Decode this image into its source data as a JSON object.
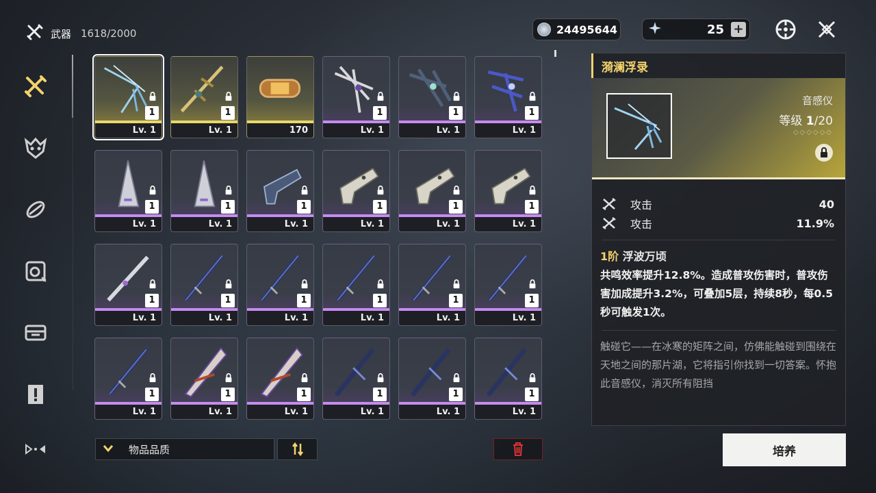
{
  "header": {
    "title": "武器",
    "count": "1618/2000"
  },
  "currency": {
    "amount": "24495644",
    "icon": "coin-icon"
  },
  "stamina": {
    "amount": "25",
    "plus": "+"
  },
  "top_icons": [
    "compass-icon",
    "close-icon"
  ],
  "left_nav": [
    "weapon-icon",
    "echo-icon",
    "upgrade-material-icon",
    "synthesis-icon",
    "resource-icon",
    "quest-item-icon",
    "misc-icon"
  ],
  "items": [
    {
      "label": "Lv. 1",
      "qty": "1",
      "rarity": "gold",
      "locked": true,
      "selected": true,
      "kind": "rectifier"
    },
    {
      "label": "Lv. 1",
      "qty": "1",
      "rarity": "gold",
      "locked": true,
      "kind": "sword-gold"
    },
    {
      "label": "170",
      "qty": "",
      "rarity": "gold",
      "locked": false,
      "kind": "capsule"
    },
    {
      "label": "Lv. 1",
      "qty": "1",
      "rarity": "purple",
      "locked": true,
      "kind": "rectifier-silver"
    },
    {
      "label": "Lv. 1",
      "qty": "1",
      "rarity": "purple",
      "locked": true,
      "kind": "rectifier-dark"
    },
    {
      "label": "Lv. 1",
      "qty": "1",
      "rarity": "purple",
      "locked": true,
      "kind": "rectifier-blue"
    },
    {
      "label": "Lv. 1",
      "qty": "1",
      "rarity": "purple",
      "locked": true,
      "kind": "gauntlet"
    },
    {
      "label": "Lv. 1",
      "qty": "1",
      "rarity": "purple",
      "locked": true,
      "kind": "gauntlet"
    },
    {
      "label": "Lv. 1",
      "qty": "1",
      "rarity": "purple",
      "locked": true,
      "kind": "pistol"
    },
    {
      "label": "Lv. 1",
      "qty": "1",
      "rarity": "purple",
      "locked": true,
      "kind": "pistol-white"
    },
    {
      "label": "Lv. 1",
      "qty": "1",
      "rarity": "purple",
      "locked": true,
      "kind": "pistol-white"
    },
    {
      "label": "Lv. 1",
      "qty": "1",
      "rarity": "purple",
      "locked": true,
      "kind": "pistol-white"
    },
    {
      "label": "Lv. 1",
      "qty": "1",
      "rarity": "purple",
      "locked": true,
      "kind": "sword"
    },
    {
      "label": "Lv. 1",
      "qty": "1",
      "rarity": "purple",
      "locked": true,
      "kind": "blade"
    },
    {
      "label": "Lv. 1",
      "qty": "1",
      "rarity": "purple",
      "locked": true,
      "kind": "blade"
    },
    {
      "label": "Lv. 1",
      "qty": "1",
      "rarity": "purple",
      "locked": true,
      "kind": "blade"
    },
    {
      "label": "Lv. 1",
      "qty": "1",
      "rarity": "purple",
      "locked": true,
      "kind": "blade"
    },
    {
      "label": "Lv. 1",
      "qty": "1",
      "rarity": "purple",
      "locked": true,
      "kind": "blade"
    },
    {
      "label": "Lv. 1",
      "qty": "1",
      "rarity": "purple",
      "locked": true,
      "kind": "blade"
    },
    {
      "label": "Lv. 1",
      "qty": "1",
      "rarity": "purple",
      "locked": true,
      "kind": "broadblade"
    },
    {
      "label": "Lv. 1",
      "qty": "1",
      "rarity": "purple",
      "locked": true,
      "kind": "broadblade"
    },
    {
      "label": "Lv. 1",
      "qty": "1",
      "rarity": "purple",
      "locked": true,
      "kind": "greatsword"
    },
    {
      "label": "Lv. 1",
      "qty": "1",
      "rarity": "purple",
      "locked": true,
      "kind": "greatsword"
    },
    {
      "label": "Lv. 1",
      "qty": "1",
      "rarity": "purple",
      "locked": true,
      "kind": "greatsword"
    }
  ],
  "controls": {
    "sort_label": "物品品质",
    "sort_icon": "chevron-down-icon",
    "order_icon": "sort-order-icon",
    "delete_icon": "trash-icon"
  },
  "detail": {
    "name": "漪澜浮录",
    "type": "音感仪",
    "level_label": "等级",
    "level_current": "1",
    "level_max": "/20",
    "dots": "◇◇◇◇◇◇",
    "stats": [
      {
        "name": "攻击",
        "value": "40"
      },
      {
        "name": "攻击",
        "value": "11.9%"
      }
    ],
    "skill_rank": "1阶",
    "skill_name": "浮波万顷",
    "skill_desc": "共鸣效率提升12.8%。造成普攻伤害时，普攻伤害加成提升3.2%，可叠加5层，持续8秒，每0.5秒可触发1次。",
    "lore": "触碰它——在冰寒的矩阵之间，仿佛能触碰到围绕在天地之间的那片湖，它将指引你找到一切答案。怀抱此音感仪，消灭所有阻挡"
  },
  "cultivate_label": "培养",
  "colors": {
    "accent_gold": "#f3d36c",
    "rarity_gold": "#e9d86a",
    "rarity_purple": "#c58cf0"
  }
}
